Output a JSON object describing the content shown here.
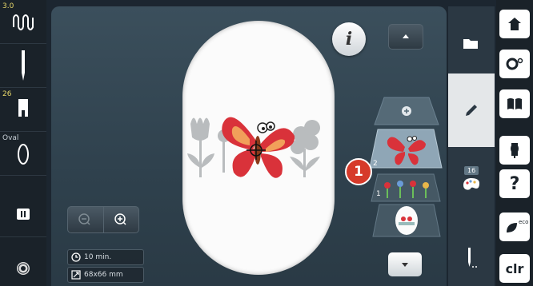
{
  "left_panel": {
    "stitch": {
      "value": "3.0",
      "icon": "stitch-pattern-icon"
    },
    "needle": {
      "icon": "needle-icon"
    },
    "presser_foot": {
      "number": "26",
      "icon": "presser-foot-icon"
    },
    "hoop": {
      "label": "Oval",
      "icon": "oval-hoop-icon"
    },
    "stitch_plate": {
      "icon": "stitch-plate-icon"
    },
    "bobbin": {
      "icon": "bobbin-icon"
    }
  },
  "canvas": {
    "info_button_label": "i",
    "time": "10 min.",
    "size": "68x66 mm",
    "callout": "1"
  },
  "layers": {
    "add_label": "+",
    "items": [
      {
        "number": "2",
        "name": "butterfly"
      },
      {
        "number": "1",
        "name": "flowers"
      },
      {
        "number": "",
        "name": "full-design"
      }
    ]
  },
  "tabs": {
    "color_count": "16"
  },
  "right_panel": {
    "clear_label": "clr",
    "eco_label": "eco",
    "help_label": "?"
  },
  "colors": {
    "background": "#1c2630",
    "hoop": "#fbfbfb",
    "callout": "#d63a2a",
    "butterfly": "#d9323a",
    "flower_gray": "#b9bcbe",
    "accent_yellow": "#e8d86a"
  }
}
